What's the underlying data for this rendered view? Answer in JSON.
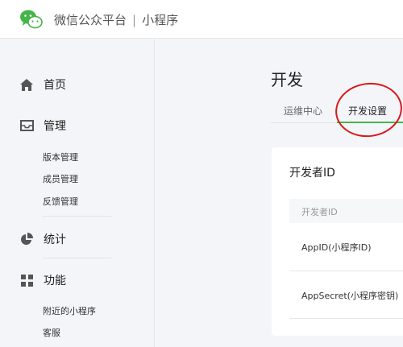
{
  "header": {
    "brand": "微信公众平台",
    "separator": "|",
    "product": "小程序"
  },
  "sidebar": {
    "home": {
      "label": "首页",
      "icon": "home-icon"
    },
    "manage": {
      "label": "管理",
      "icon": "inbox-icon",
      "items": [
        "版本管理",
        "成员管理",
        "反馈管理"
      ]
    },
    "stats": {
      "label": "统计",
      "icon": "pie-chart-icon"
    },
    "features": {
      "label": "功能",
      "icon": "grid-icon",
      "items": [
        "附近的小程序",
        "客服"
      ]
    }
  },
  "main": {
    "title": "开发",
    "tabs": [
      {
        "label": "运维中心"
      },
      {
        "label": "开发设置",
        "active": true
      }
    ],
    "card": {
      "title": "开发者ID",
      "table_header": "开发者ID",
      "rows": [
        "AppID(小程序ID)",
        "AppSecret(小程序密钥)"
      ]
    }
  },
  "colors": {
    "accent": "#44b549",
    "annotation": "#d71a1a"
  }
}
